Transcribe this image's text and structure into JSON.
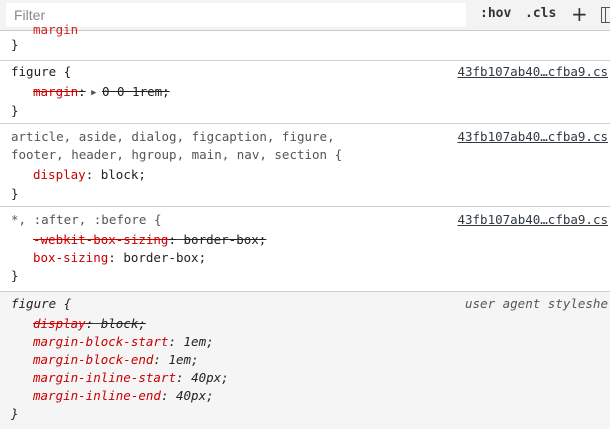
{
  "toolbar": {
    "filter_placeholder": "Filter",
    "hov_label": ":hov",
    "cls_label": ".cls",
    "plus_label": "+"
  },
  "top_fragment": {
    "decl_fragment": "margin",
    "brace": "}"
  },
  "rules": [
    {
      "selector_line1": "figure {",
      "source": "43fb107ab40…cfba9.cs",
      "declarations": [
        {
          "property": "margin",
          "value": "0 0 1rem;",
          "overridden": true
        }
      ]
    },
    {
      "selector_line1": "article, aside, dialog, figcaption, figure,",
      "selector_line2": "footer, header, hgroup, main, nav, section {",
      "source": "43fb107ab40…cfba9.cs",
      "declarations": [
        {
          "property": "display",
          "value": "block;",
          "overridden": false
        }
      ]
    },
    {
      "selector_line1": "*, :after, :before {",
      "source": "43fb107ab40…cfba9.cs",
      "declarations": [
        {
          "property": "-webkit-box-sizing",
          "value": "border-box;",
          "overridden": true
        },
        {
          "property": "box-sizing",
          "value": "border-box;",
          "overridden": false
        }
      ]
    },
    {
      "selector_line1": "figure {",
      "source": "user agent styleshe",
      "declarations": [
        {
          "property": "display",
          "value": "block;",
          "overridden": true
        },
        {
          "property": "margin-block-start",
          "value": "1em;",
          "overridden": false
        },
        {
          "property": "margin-block-end",
          "value": "1em;",
          "overridden": false
        },
        {
          "property": "margin-inline-start",
          "value": "40px;",
          "overridden": false
        },
        {
          "property": "margin-inline-end",
          "value": "40px;",
          "overridden": false
        }
      ]
    }
  ],
  "close_brace": "}",
  "colon": ":"
}
